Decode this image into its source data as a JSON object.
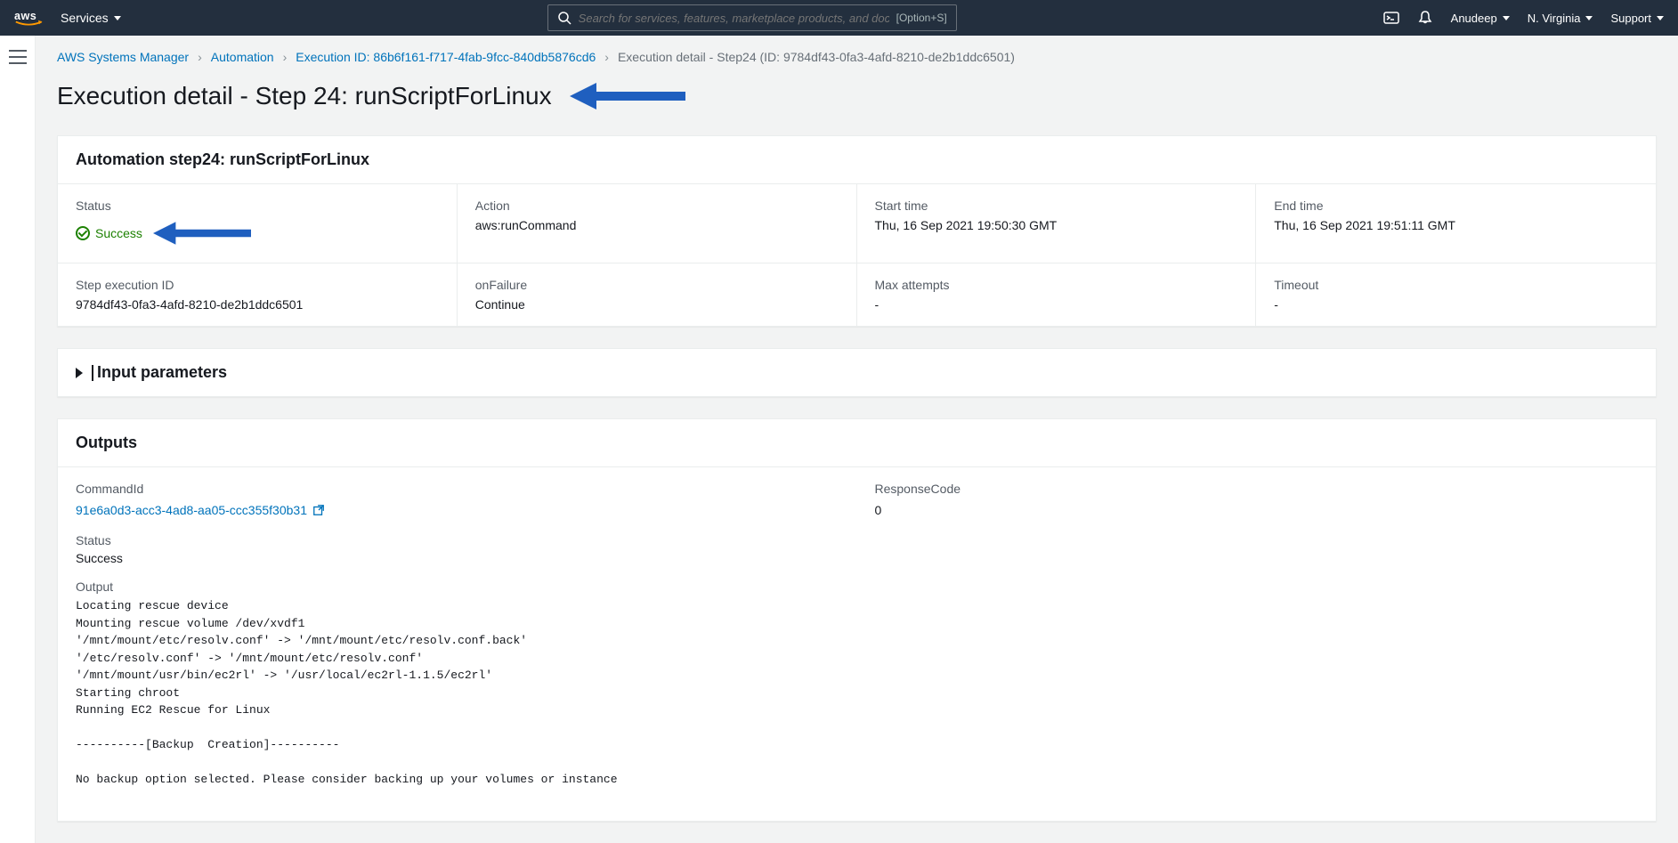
{
  "topnav": {
    "services_label": "Services",
    "search_placeholder": "Search for services, features, marketplace products, and docs",
    "search_shortcut": "[Option+S]",
    "user": "Anudeep",
    "region": "N. Virginia",
    "support": "Support"
  },
  "breadcrumb": {
    "items": [
      {
        "label": "AWS Systems Manager",
        "link": true
      },
      {
        "label": "Automation",
        "link": true
      },
      {
        "label": "Execution ID: 86b6f161-f717-4fab-9fcc-840db5876cd6",
        "link": true
      },
      {
        "label": "Execution detail - Step24 (ID: 9784df43-0fa3-4afd-8210-de2b1ddc6501)",
        "link": false
      }
    ]
  },
  "page_title": "Execution detail - Step 24: runScriptForLinux",
  "step_panel": {
    "header": "Automation step24: runScriptForLinux",
    "row1": {
      "status_label": "Status",
      "status_value": "Success",
      "action_label": "Action",
      "action_value": "aws:runCommand",
      "start_label": "Start time",
      "start_value": "Thu, 16 Sep 2021 19:50:30 GMT",
      "end_label": "End time",
      "end_value": "Thu, 16 Sep 2021 19:51:11 GMT"
    },
    "row2": {
      "stepid_label": "Step execution ID",
      "stepid_value": "9784df43-0fa3-4afd-8210-de2b1ddc6501",
      "onfailure_label": "onFailure",
      "onfailure_value": "Continue",
      "max_label": "Max attempts",
      "max_value": "-",
      "timeout_label": "Timeout",
      "timeout_value": "-"
    }
  },
  "input_params_header": "Input parameters",
  "outputs": {
    "header": "Outputs",
    "commandid_label": "CommandId",
    "commandid_value": "91e6a0d3-acc3-4ad8-aa05-ccc355f30b31",
    "responsecode_label": "ResponseCode",
    "responsecode_value": "0",
    "status_label": "Status",
    "status_value": "Success",
    "output_label": "Output",
    "output_text": "Locating rescue device\nMounting rescue volume /dev/xvdf1\n'/mnt/mount/etc/resolv.conf' -> '/mnt/mount/etc/resolv.conf.back'\n'/etc/resolv.conf' -> '/mnt/mount/etc/resolv.conf'\n'/mnt/mount/usr/bin/ec2rl' -> '/usr/local/ec2rl-1.1.5/ec2rl'\nStarting chroot\nRunning EC2 Rescue for Linux\n\n----------[Backup  Creation]----------\n\nNo backup option selected. Please consider backing up your volumes or instance"
  }
}
